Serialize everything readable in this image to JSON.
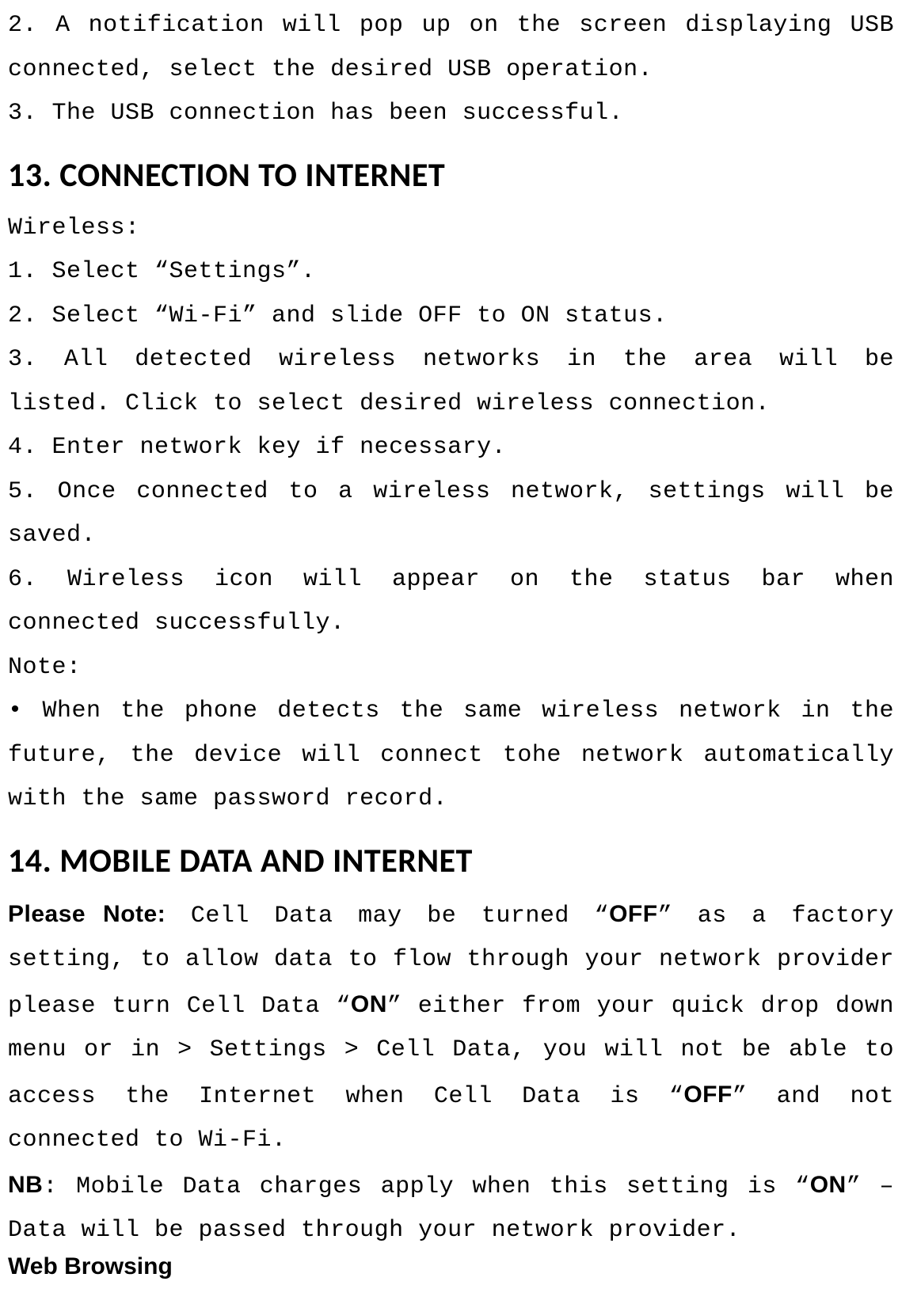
{
  "intro": {
    "p1": "2. A notification will pop up on the screen displaying USB connected, select the desired USB operation.",
    "p2": "3. The USB connection has been successful."
  },
  "section13": {
    "heading": "13. CONNECTION TO INTERNET",
    "wireless_label": "Wireless:",
    "steps": {
      "s1": "1. Select “Settings”.",
      "s2": "2. Select “Wi-Fi” and slide OFF to ON status.",
      "s3": "3. All detected wireless networks in the area will be listed. Click to select desired  wireless connection.",
      "s4": "4. Enter network key if necessary.",
      "s5": "5. Once connected to a wireless network, settings will be saved.",
      "s6": "6. Wireless icon will appear on the status bar when connected successfully."
    },
    "note_label": "Note:",
    "note_bullet": "• When the phone detects the same wireless network in the future, the device will connect tohe network automatically with the same password record."
  },
  "section14": {
    "heading": "14. MOBILE DATA AND INTERNET",
    "please_note_label": "Please Note:",
    "pn_part1": " Cell Data may be turned “",
    "pn_off1": "OFF",
    "pn_part2": "” as a factory setting, to allow data to flow through your network provider please turn Cell Data “",
    "pn_on": "ON",
    "pn_part3": "” either from your quick drop down menu or in > Settings > Cell Data, you will not be able to access the Internet when Cell Data is “",
    "pn_off2": "OFF",
    "pn_part4": "” and not connected to Wi-Fi.",
    "nb_label": "NB",
    "nb_part1": ": Mobile Data charges apply when this setting is “",
    "nb_on": "ON",
    "nb_part2": "” – Data will be passed through your network provider.",
    "web_browsing": "Web Browsing"
  }
}
